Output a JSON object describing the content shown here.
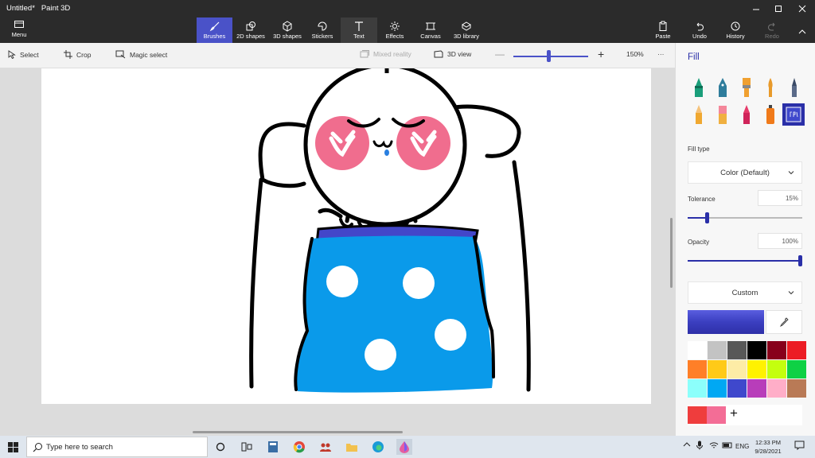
{
  "app": {
    "file_name": "Untitled*",
    "app_name": "Paint 3D"
  },
  "ribbon": {
    "menu_label": "Menu",
    "tools": [
      {
        "label": "Brushes",
        "icon": "brush-icon",
        "active": true
      },
      {
        "label": "2D shapes",
        "icon": "2d-shapes-icon"
      },
      {
        "label": "3D shapes",
        "icon": "3d-shapes-icon"
      },
      {
        "label": "Stickers",
        "icon": "stickers-icon"
      },
      {
        "label": "Text",
        "icon": "text-icon"
      },
      {
        "label": "Effects",
        "icon": "effects-icon"
      },
      {
        "label": "Canvas",
        "icon": "canvas-icon"
      },
      {
        "label": "3D library",
        "icon": "3d-library-icon"
      }
    ],
    "right": [
      {
        "label": "Paste",
        "icon": "paste-icon"
      },
      {
        "label": "Undo",
        "icon": "undo-icon"
      },
      {
        "label": "History",
        "icon": "history-icon"
      },
      {
        "label": "Redo",
        "icon": "redo-icon",
        "disabled": true
      }
    ]
  },
  "toolbar": {
    "select": "Select",
    "crop": "Crop",
    "magic_select": "Magic select",
    "mixed_reality": "Mixed reality",
    "view_3d": "3D view",
    "zoom": "150%",
    "zoom_level": 0.45,
    "more": "···"
  },
  "panel": {
    "title": "Fill",
    "fill_type_label": "Fill type",
    "fill_type_value": "Color (Default)",
    "tolerance_label": "Tolerance",
    "tolerance_value": "15%",
    "tolerance_level": 0.15,
    "opacity_label": "Opacity",
    "opacity_value": "100%",
    "opacity_level": 1.0,
    "color_mode": "Custom",
    "current_color": "#3b3fc0",
    "brushes": [
      "marker-icon",
      "calligraphy-pen-icon",
      "oil-brush-icon",
      "watercolor-icon",
      "pixel-pen-icon",
      "pencil-icon",
      "eraser-icon",
      "crayon-icon",
      "spray-can-icon",
      "fill-bucket-icon"
    ],
    "palette": [
      "#ffffff",
      "#c3c3c3",
      "#585858",
      "#000000",
      "#88001b",
      "#ec1c24",
      "#ff7f27",
      "#ffca18",
      "#fdeca6",
      "#fff200",
      "#c4ff0e",
      "#0ed145",
      "#8cfffb",
      "#00a8f3",
      "#3f48cc",
      "#b83dba",
      "#ffaec8",
      "#b97a56"
    ],
    "recent": [
      "#ef3d3d",
      "#f36d96"
    ],
    "add_label": "+"
  },
  "taskbar": {
    "search_placeholder": "Type here to search",
    "language": "ENG",
    "time": "12:33 PM",
    "date": "9/28/2021"
  }
}
